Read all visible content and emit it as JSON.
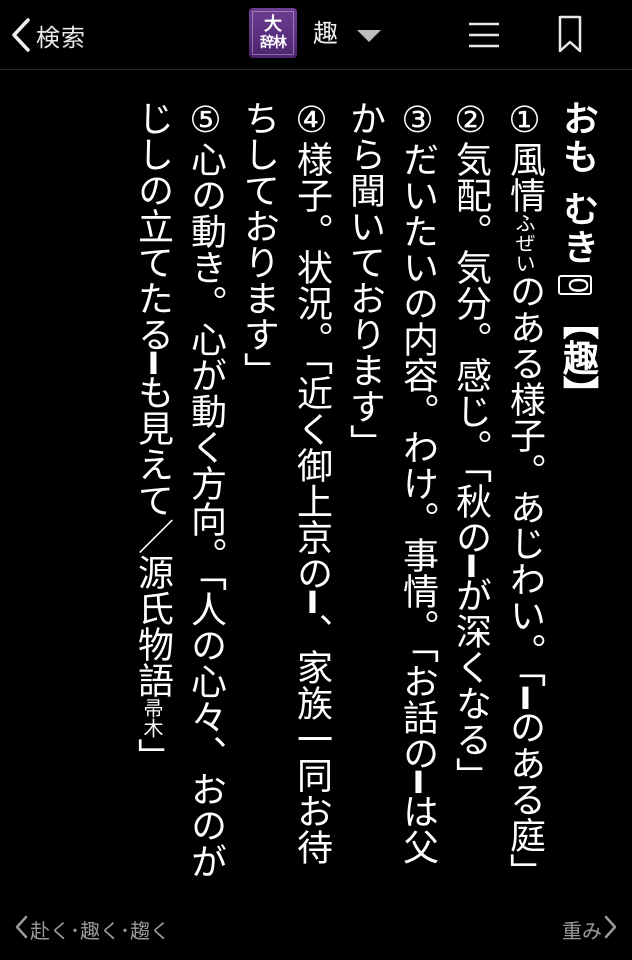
{
  "header": {
    "back_label": "検索",
    "dict_logo_top": "大",
    "dict_logo_bottom": "辞林",
    "head_word": "趣"
  },
  "entry": {
    "reading": "おも むき",
    "accent": "0",
    "kanji": "【趣】",
    "lines": [
      "①風情",
      "ふぜい",
      "のある様子。あじわい。「",
      "のある庭」",
      "②気配。気分。感じ。「秋の",
      "が深くなる」",
      "③だいたいの内容。わけ。事情。「お話の",
      "は父から聞いております」",
      "④様子。状況。「近く御上京の",
      "、家族一同お待ちしております」",
      "⑤心の動き。心が動く方向。「人の心々、おのがじしの立てたる",
      "も見えて／源氏物語",
      "帚木",
      "」"
    ],
    "bar": "━"
  },
  "footer": {
    "prev_label": "赴く･趣く･趨く",
    "next_label": "重み"
  }
}
